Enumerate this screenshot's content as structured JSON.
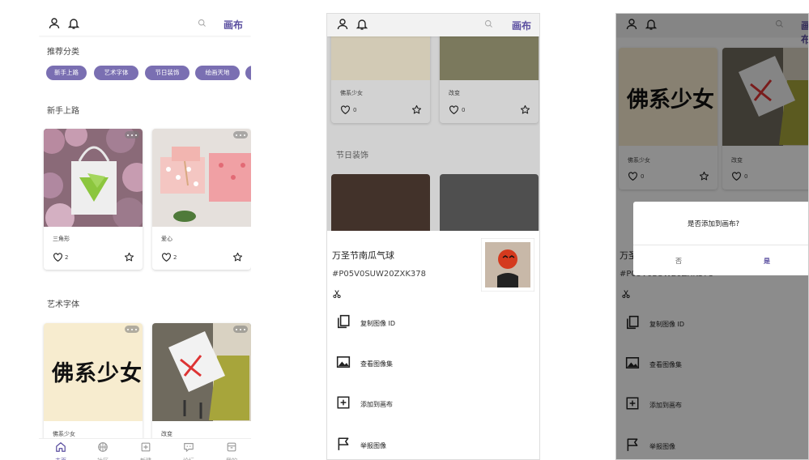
{
  "header": {
    "canvas_label": "画布"
  },
  "home": {
    "section_recommended": "推荐分类",
    "chips": [
      "新手上路",
      "艺术字体",
      "节日装饰",
      "绘画天地"
    ],
    "section_beginner": "新手上路",
    "section_art_fonts": "艺术字体",
    "cards_beginner": [
      {
        "caption": "三角形",
        "likes": "2"
      },
      {
        "caption": "爱心",
        "likes": "2"
      }
    ],
    "cards_art": [
      {
        "caption": "佛系少女"
      },
      {
        "caption": "改变"
      }
    ],
    "art_text": "佛系少女"
  },
  "nav": [
    {
      "label": "主页",
      "icon": "home-icon",
      "active": true
    },
    {
      "label": "社区",
      "icon": "basketball-icon",
      "active": false
    },
    {
      "label": "新建",
      "icon": "plus-square-icon",
      "active": false
    },
    {
      "label": "论坛",
      "icon": "chat-icon",
      "active": false
    },
    {
      "label": "我的",
      "icon": "box-icon",
      "active": false
    }
  ],
  "detail": {
    "cards": [
      {
        "caption": "佛系少女",
        "likes": "0"
      },
      {
        "caption": "改变",
        "likes": "0"
      }
    ],
    "section_festival": "节日装饰",
    "title": "万圣节南瓜气球",
    "code": "#P05V0SUW20ZXK378",
    "actions": [
      "复制图像 ID",
      "查看图像集",
      "添加到画布",
      "举报图像"
    ]
  },
  "dialog": {
    "question": "是否添加到画布?",
    "no": "否",
    "yes": "是"
  },
  "colors": {
    "accent": "#5b4fa0",
    "chip": "#7a6fb2",
    "text": "#222222"
  }
}
